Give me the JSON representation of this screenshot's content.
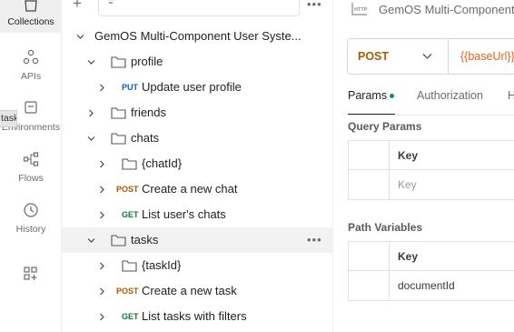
{
  "rail": {
    "items": [
      {
        "label": "Collections",
        "icon": "collections-icon"
      },
      {
        "label": "APIs",
        "icon": "apis-icon"
      },
      {
        "label": "Environments",
        "icon": "environments-icon"
      },
      {
        "label": "Flows",
        "icon": "flows-icon"
      },
      {
        "label": "History",
        "icon": "history-icon"
      }
    ],
    "tooltip": "tasks"
  },
  "sidebar": {
    "collection_name": "GemOS Multi-Component User Syste...",
    "tree": [
      {
        "type": "folder",
        "name": "profile"
      },
      {
        "type": "request",
        "method": "PUT",
        "name": "Update user profile"
      },
      {
        "type": "folder",
        "name": "friends"
      },
      {
        "type": "folder",
        "name": "chats"
      },
      {
        "type": "folder",
        "name": "{chatId}"
      },
      {
        "type": "request",
        "method": "POST",
        "name": "Create a new chat"
      },
      {
        "type": "request",
        "method": "GET",
        "name": "List user's chats"
      },
      {
        "type": "folder",
        "name": "tasks"
      },
      {
        "type": "folder",
        "name": "{taskId}"
      },
      {
        "type": "request",
        "method": "POST",
        "name": "Create a new task"
      },
      {
        "type": "request",
        "method": "GET",
        "name": "List tasks with filters"
      }
    ]
  },
  "main": {
    "header_title": "GemOS Multi-Component",
    "method": "POST",
    "url": "{{baseUrl}}",
    "tabs": [
      "Params",
      "Authorization",
      "H"
    ],
    "query_params": {
      "title": "Query Params",
      "header": "Key",
      "placeholder": "Key"
    },
    "path_variables": {
      "title": "Path Variables",
      "header": "Key",
      "rows": [
        "documentId"
      ]
    }
  },
  "colors": {
    "put": "#0c5bc5",
    "post": "#a75c00",
    "get": "#0b7a35",
    "url_variable": "#e4631c",
    "params_dot": "#0b9d44"
  }
}
